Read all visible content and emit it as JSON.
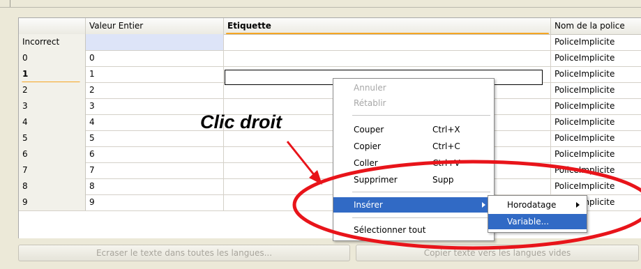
{
  "columns": [
    "",
    "Valeur Entier",
    "Etiquette",
    "Nom de la police"
  ],
  "rows": [
    {
      "header": "Incorrect",
      "value": "",
      "label": "",
      "font": "PoliceImplicite"
    },
    {
      "header": "0",
      "value": "0",
      "label": "",
      "font": "PoliceImplicite"
    },
    {
      "header": "1",
      "value": "1",
      "label": "",
      "font": "PoliceImplicite"
    },
    {
      "header": "2",
      "value": "2",
      "label": "",
      "font": "PoliceImplicite"
    },
    {
      "header": "3",
      "value": "3",
      "label": "",
      "font": "PoliceImplicite"
    },
    {
      "header": "4",
      "value": "4",
      "label": "",
      "font": "PoliceImplicite"
    },
    {
      "header": "5",
      "value": "5",
      "label": "",
      "font": "PoliceImplicite"
    },
    {
      "header": "6",
      "value": "6",
      "label": "",
      "font": "PoliceImplicite"
    },
    {
      "header": "7",
      "value": "7",
      "label": "",
      "font": "PoliceImplicite"
    },
    {
      "header": "8",
      "value": "8",
      "label": "",
      "font": "PoliceImplicite"
    },
    {
      "header": "9",
      "value": "9",
      "label": "",
      "font": "PoliceImplicite"
    }
  ],
  "buttons": {
    "overwrite": "Ecraser le texte dans toutes les langues...",
    "copy": "Copier texte vers les langues vides"
  },
  "context_menu": {
    "undo": "Annuler",
    "redo": "Rétablir",
    "cut": "Couper",
    "cut_shortcut": "Ctrl+X",
    "copy": "Copier",
    "copy_shortcut": "Ctrl+C",
    "paste": "Coller",
    "paste_shortcut": "Ctrl+V",
    "delete": "Supprimer",
    "delete_shortcut": "Supp",
    "insert": "Insérer",
    "select_all": "Sélectionner tout"
  },
  "submenu": {
    "timestamp": "Horodatage",
    "variable": "Variable..."
  },
  "annotation": "Clic droit",
  "colors": {
    "accent_orange": "#f5a623",
    "highlight_blue": "#316ac5",
    "annotation_red": "#e8141a"
  }
}
